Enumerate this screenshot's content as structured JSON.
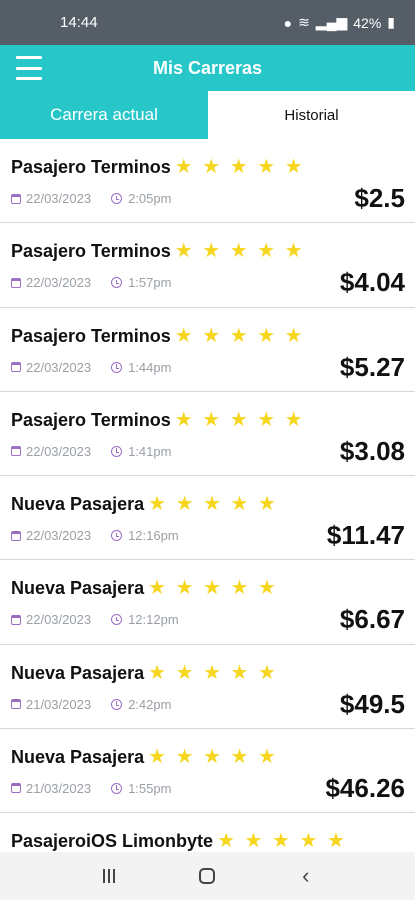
{
  "status_bar": {
    "time": "14:44",
    "battery": "42%"
  },
  "header": {
    "title": "Mis Carreras"
  },
  "tabs": {
    "current": "Carrera actual",
    "history": "Historial"
  },
  "stars_text": "★ ★ ★ ★ ★",
  "colors": {
    "accent": "#26c6c9",
    "star": "#f6d61e",
    "icon": "#9a6fc4"
  },
  "rides": [
    {
      "name": "Pasajero Terminos",
      "rating": 5,
      "date": "22/03/2023",
      "time": "2:05pm",
      "price": "$2.5"
    },
    {
      "name": "Pasajero Terminos",
      "rating": 5,
      "date": "22/03/2023",
      "time": "1:57pm",
      "price": "$4.04"
    },
    {
      "name": "Pasajero Terminos",
      "rating": 5,
      "date": "22/03/2023",
      "time": "1:44pm",
      "price": "$5.27"
    },
    {
      "name": "Pasajero Terminos",
      "rating": 5,
      "date": "22/03/2023",
      "time": "1:41pm",
      "price": "$3.08"
    },
    {
      "name": "Nueva Pasajera",
      "rating": 5,
      "date": "22/03/2023",
      "time": "12:16pm",
      "price": "$11.47"
    },
    {
      "name": "Nueva Pasajera",
      "rating": 5,
      "date": "22/03/2023",
      "time": "12:12pm",
      "price": "$6.67"
    },
    {
      "name": "Nueva Pasajera",
      "rating": 5,
      "date": "21/03/2023",
      "time": "2:42pm",
      "price": "$49.5"
    },
    {
      "name": "Nueva Pasajera",
      "rating": 5,
      "date": "21/03/2023",
      "time": "1:55pm",
      "price": "$46.26"
    },
    {
      "name": "PasajeroiOS Limonbyte",
      "rating": 5
    }
  ]
}
